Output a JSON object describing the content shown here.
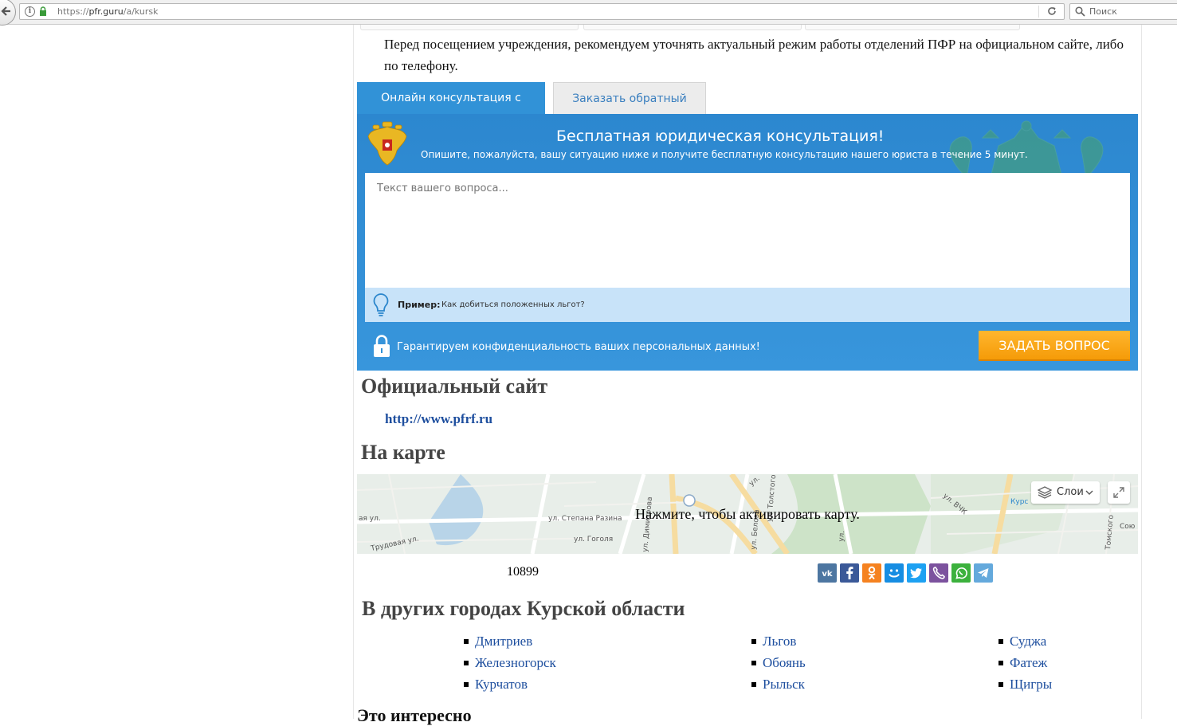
{
  "browser": {
    "url_prefix": "https://",
    "url_domain": "pfr.guru",
    "url_path": "/a/kursk",
    "search_placeholder": "Поиск"
  },
  "notice": "Перед посещением учреждения, рекомендуем уточнять актуальный режим работы отделений ПФР на официальном сайте, либо по телефону.",
  "consult": {
    "tab_online": "Онлайн консультация с юристом",
    "tab_callback": "Заказать обратный звонок",
    "title": "Бесплатная юридическая консультация!",
    "subtitle": "Опишите, пожалуйста, вашу ситуацию ниже и получите бесплатную консультацию нашего юриста в течение 5 минут.",
    "placeholder": "Текст вашего вопроса...",
    "example_label": "Пример:",
    "example_text": "Как добиться положенных льгот?",
    "privacy": "Гарантируем конфиденциальность ваших персональных данных!",
    "ask_button": "ЗАДАТЬ ВОПРОС",
    "colors": {
      "panel": "#3192d7",
      "button": "#f8a818"
    }
  },
  "official": {
    "heading": "Официальный сайт",
    "link": "http://www.pfrf.ru"
  },
  "map": {
    "heading": "На карте",
    "hint": "Нажмите, чтобы активировать карту.",
    "layers_label": "Слои",
    "streets": [
      "ул. Степана Разина",
      "ул. Гоголя",
      "Трудовая ул.",
      "ул. ВЧК",
      "ул. Толстого",
      "ул. Белова",
      "ул. Димитрова",
      "ул.",
      "ая ул.",
      "ул.",
      "Курс",
      "Сою",
      "Томского"
    ]
  },
  "counter": "10899",
  "share": [
    {
      "name": "vk-icon",
      "color": "#4d76a1"
    },
    {
      "name": "facebook-icon",
      "color": "#3b5998"
    },
    {
      "name": "odnoklassniki-icon",
      "color": "#f58220"
    },
    {
      "name": "moimir-icon",
      "color": "#168de2"
    },
    {
      "name": "twitter-icon",
      "color": "#1da1f2"
    },
    {
      "name": "viber-icon",
      "color": "#7c529e"
    },
    {
      "name": "whatsapp-icon",
      "color": "#3cb13d"
    },
    {
      "name": "telegram-icon",
      "color": "#64a9dc"
    }
  ],
  "cities": {
    "heading": "В других городах Курской области",
    "col1": [
      "Дмитриев",
      "Железногорск",
      "Курчатов"
    ],
    "col2": [
      "Льгов",
      "Обоянь",
      "Рыльск"
    ],
    "col3": [
      "Суджа",
      "Фатеж",
      "Щигры"
    ]
  },
  "interesting_heading": "Это интересно"
}
